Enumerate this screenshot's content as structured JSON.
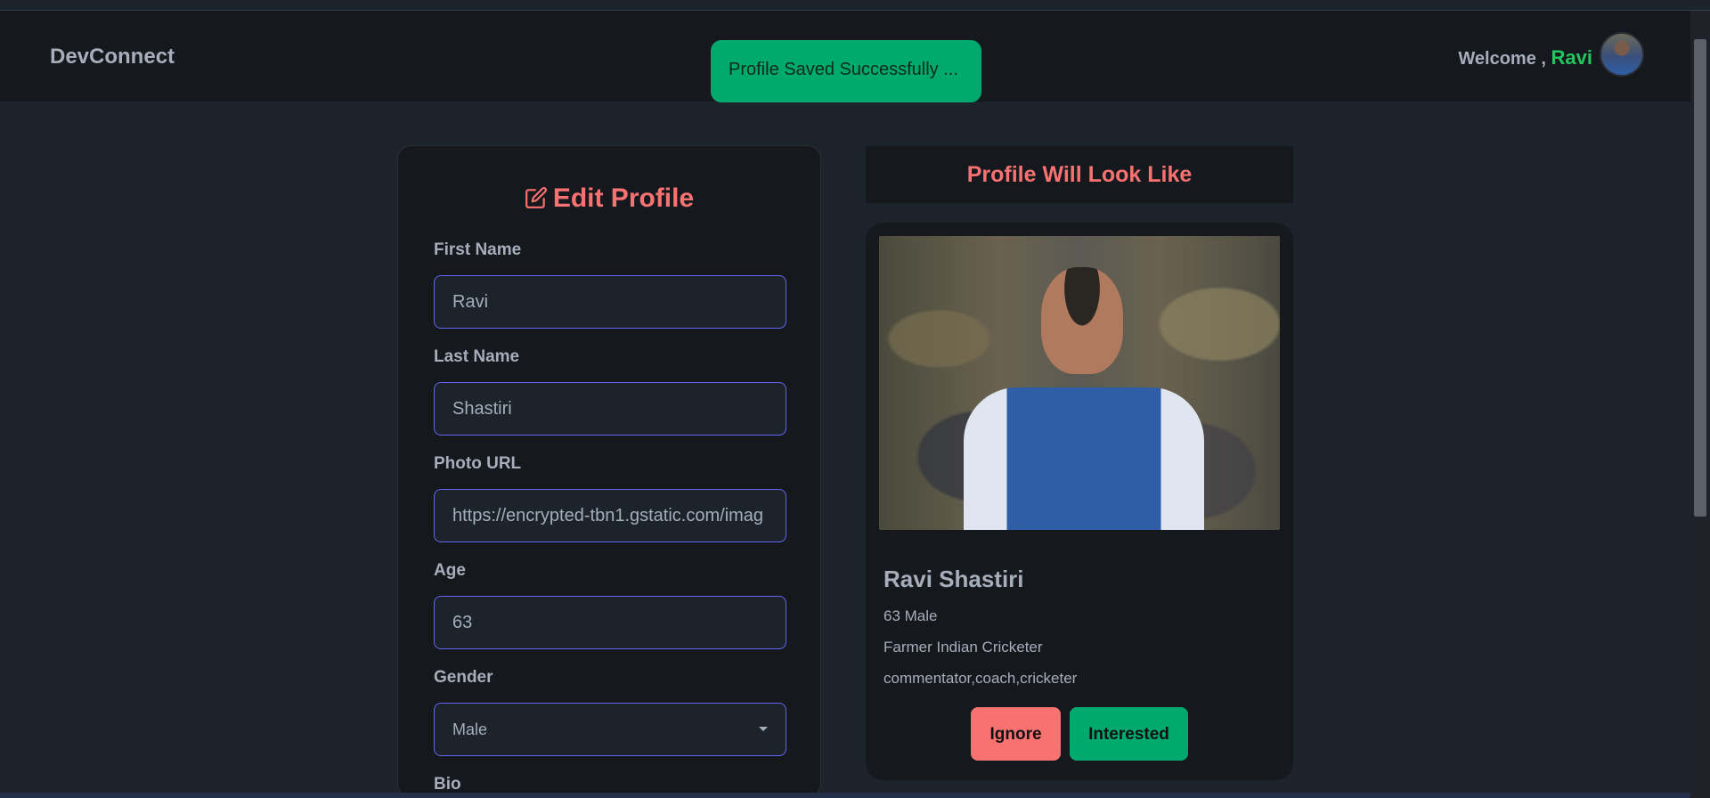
{
  "navbar": {
    "brand": "DevConnect",
    "welcome_prefix": "Welcome ,",
    "user_name": "Ravi"
  },
  "toast": {
    "message": "Profile Saved Successfully ..."
  },
  "edit_form": {
    "title": "Edit Profile",
    "fields": {
      "first_name": {
        "label": "First Name",
        "value": "Ravi"
      },
      "last_name": {
        "label": "Last Name",
        "value": "Shastiri"
      },
      "photo_url": {
        "label": "Photo URL",
        "value": "https://encrypted-tbn1.gstatic.com/imag"
      },
      "age": {
        "label": "Age",
        "value": "63"
      },
      "gender": {
        "label": "Gender",
        "value": "Male"
      },
      "bio": {
        "label": "Bio"
      }
    }
  },
  "preview": {
    "header": "Profile Will Look Like",
    "name": "Ravi Shastiri",
    "age_gender": "63  Male",
    "about": "Farmer Indian Cricketer",
    "skills": "commentator,coach,cricketer",
    "ignore_label": "Ignore",
    "interested_label": "Interested"
  },
  "colors": {
    "accent_red": "#f87272",
    "accent_green": "#00a96e",
    "input_border": "#6366f1",
    "background": "#1d232a"
  }
}
